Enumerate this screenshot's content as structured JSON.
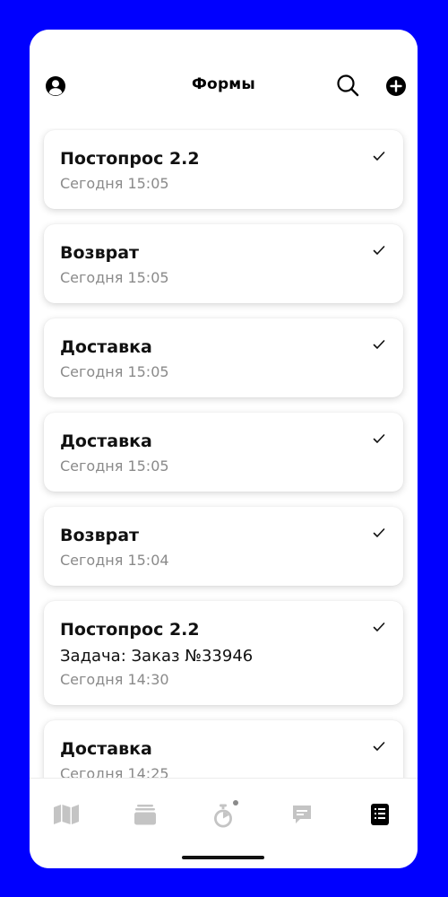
{
  "header": {
    "title": "Формы",
    "profile_icon": "user-circle-icon",
    "search_icon": "search-icon",
    "add_icon": "plus-circle-icon"
  },
  "forms": [
    {
      "name": "Постопрос 2.2",
      "task": "",
      "time": "Сегодня 15:05",
      "status_icon": "check-icon"
    },
    {
      "name": "Возврат",
      "task": "",
      "time": "Сегодня 15:05",
      "status_icon": "check-icon"
    },
    {
      "name": "Доставка",
      "task": "",
      "time": "Сегодня 15:05",
      "status_icon": "check-icon"
    },
    {
      "name": "Доставка",
      "task": "",
      "time": "Сегодня 15:05",
      "status_icon": "check-icon"
    },
    {
      "name": "Возврат",
      "task": "",
      "time": "Сегодня 15:04",
      "status_icon": "check-icon"
    },
    {
      "name": "Постопрос 2.2",
      "task": "Задача: Заказ №33946",
      "time": "Сегодня 14:30",
      "status_icon": "check-icon"
    },
    {
      "name": "Доставка",
      "task": "",
      "time": "Сегодня 14:25",
      "status_icon": "check-icon"
    }
  ],
  "tabbar": {
    "items": [
      {
        "icon": "map-icon",
        "active": false
      },
      {
        "icon": "stack-icon",
        "active": false
      },
      {
        "icon": "stopwatch-icon",
        "active": false,
        "has_badge": true
      },
      {
        "icon": "chat-icon",
        "active": false
      },
      {
        "icon": "document-list-icon",
        "active": true
      }
    ]
  },
  "colors": {
    "background": "#0000ff",
    "active": "#000000",
    "inactive": "#c4c4c4",
    "secondary_text": "#8a8a8a"
  }
}
